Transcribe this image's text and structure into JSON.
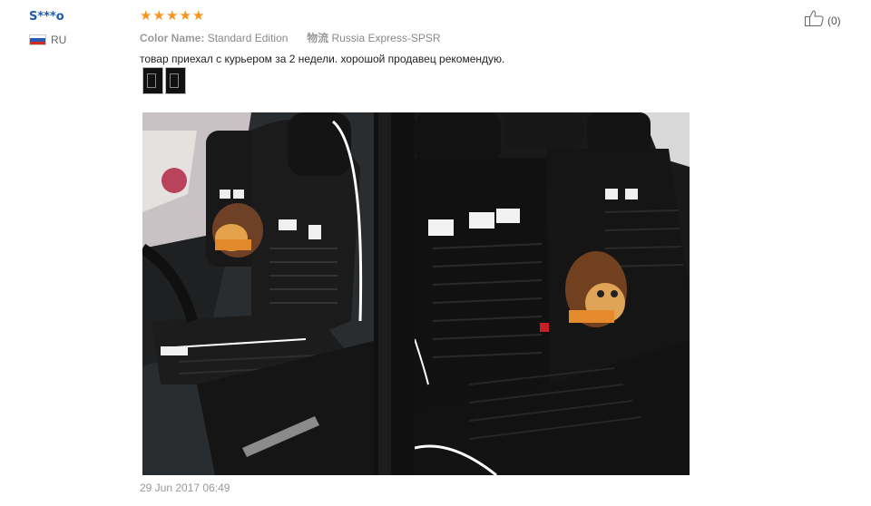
{
  "reviewer": {
    "name": "S***o",
    "country_code": "RU",
    "flag_icon": "russia-flag-icon"
  },
  "rating": {
    "stars": 5,
    "max": 5,
    "color": "#f7941d"
  },
  "product": {
    "color_label": "Color Name:",
    "color_value": "Standard Edition",
    "shipping_label": "物流",
    "shipping_value": "Russia Express-SPSR"
  },
  "review": {
    "text": "товар приехал с курьером за 2 недели. хорошой продавец рекомендую.",
    "date": "29 Jun 2017 06:49",
    "thumbnails": [
      "thumbnail-1",
      "thumbnail-2"
    ]
  },
  "helpful": {
    "icon": "thumbs-up-icon",
    "count": "(0)"
  },
  "colors": {
    "name_link": "#1d5ba7",
    "meta_text": "#999999"
  }
}
